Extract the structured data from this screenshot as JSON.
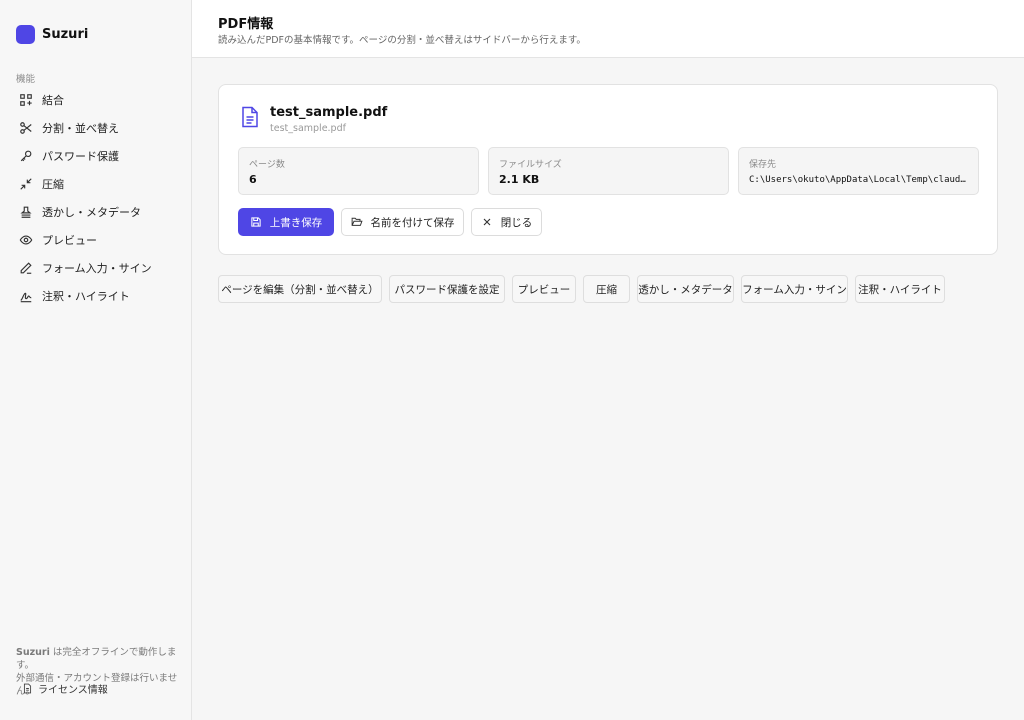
{
  "app": {
    "name": "Suzuri",
    "brand_color": "#4f46e5"
  },
  "sidebar": {
    "section_label": "機能",
    "items": [
      {
        "label": "結合",
        "icon": "merge-icon"
      },
      {
        "label": "分割・並べ替え",
        "icon": "scissors-icon"
      },
      {
        "label": "パスワード保護",
        "icon": "key-icon"
      },
      {
        "label": "圧縮",
        "icon": "compress-icon"
      },
      {
        "label": "透かし・メタデータ",
        "icon": "stamp-icon"
      },
      {
        "label": "プレビュー",
        "icon": "eye-icon"
      },
      {
        "label": "フォーム入力・サイン",
        "icon": "pen-icon"
      },
      {
        "label": "注釈・ハイライト",
        "icon": "signature-icon"
      }
    ],
    "footer_brand": "Suzuri",
    "footer_line1": " は完全オフラインで動作します。",
    "footer_line2": "外部通信・アカウント登録は行いません。",
    "license_label": "ライセンス情報"
  },
  "header": {
    "title": "PDF情報",
    "subtitle": "読み込んだPDFの基本情報です。ページの分割・並べ替えはサイドバーから行えます。"
  },
  "file": {
    "name": "test_sample.pdf",
    "subname": "test_sample.pdf",
    "stats": [
      {
        "label": "ページ数",
        "value": "6"
      },
      {
        "label": "ファイルサイズ",
        "value": "2.1 KB"
      },
      {
        "label": "保存先",
        "value": "C:\\Users\\okuto\\AppData\\Local\\Temp\\claude…"
      }
    ],
    "actions": {
      "overwrite": "上書き保存",
      "save_as": "名前を付けて保存",
      "close": "閉じる"
    }
  },
  "quick_actions": [
    "ページを編集（分割・並べ替え）",
    "パスワード保護を設定",
    "プレビュー",
    "圧縮",
    "透かし・メタデータ",
    "フォーム入力・サイン",
    "注釈・ハイライト"
  ]
}
